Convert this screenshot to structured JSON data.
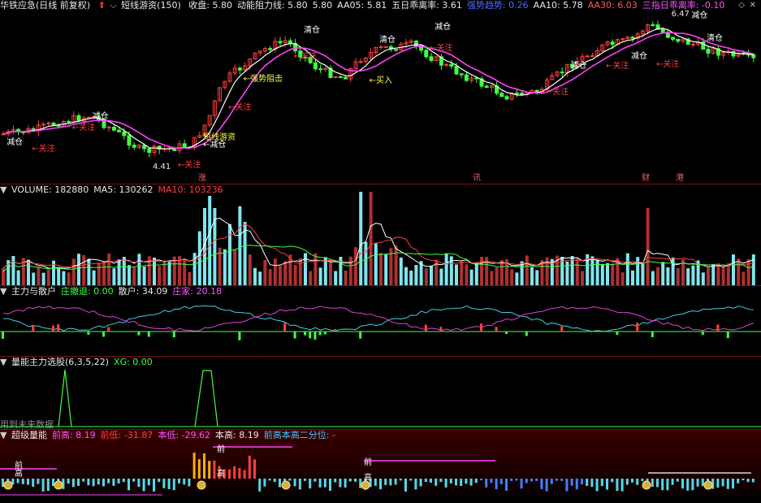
{
  "main_header": {
    "stock_title": "华铁应急(日线 前复权)",
    "indicator_name": "短线游资(150)",
    "items": [
      {
        "text": "收盘: 5.80",
        "color": "#e8e8e8"
      },
      {
        "text": "动能阻力线: 5.80",
        "color": "#e8e8e8"
      },
      {
        "text": "5.80",
        "color": "#e8e8e8"
      },
      {
        "text": "AA05: 5.81",
        "color": "#e8e8e8"
      },
      {
        "text": "五日乖离率: 3.61",
        "color": "#e8e8e8"
      },
      {
        "text": "强势趋势: 0.26",
        "color": "#4b6bff"
      },
      {
        "text": "AA10: 5.78",
        "color": "#e8e8e8"
      },
      {
        "text": "AA30: 6.03",
        "color": "#ff5a5a"
      },
      {
        "text": "三指日乖离率: -0.10",
        "color": "#ff55ff"
      }
    ],
    "arrow_icon": "up-arrow-icon",
    "settings_icon": "diamond-icon"
  },
  "main_chart_labels": {
    "annotations": [
      {
        "text": "减仓",
        "color": "#ffffff"
      },
      {
        "text": "←关注",
        "color": "#ff4040"
      },
      {
        "text": "减仓",
        "color": "#ffffff"
      },
      {
        "text": "←关注",
        "color": "#ff4040"
      },
      {
        "text": "4.41",
        "color": "#e8e8e8"
      },
      {
        "text": "←关注",
        "color": "#ff4040"
      },
      {
        "text": "←减仓",
        "color": "#ffffff"
      },
      {
        "text": "短线游资",
        "color": "#ffff40"
      },
      {
        "text": "←关注",
        "color": "#ff4040"
      },
      {
        "text": "←强势阻击",
        "color": "#ffff40"
      },
      {
        "text": "清仓",
        "color": "#ffffff"
      },
      {
        "text": "←关注",
        "color": "#ff4040"
      },
      {
        "text": "清仓",
        "color": "#ffffff"
      },
      {
        "text": "←买入",
        "color": "#ffff40"
      },
      {
        "text": "减仓",
        "color": "#ffffff"
      },
      {
        "text": "←关注",
        "color": "#ff4040"
      },
      {
        "text": "清仓",
        "color": "#ffffff"
      },
      {
        "text": "←关注",
        "color": "#ff4040"
      },
      {
        "text": "减仓",
        "color": "#ffffff"
      },
      {
        "text": "←关注",
        "color": "#ff4040"
      },
      {
        "text": "6.47",
        "color": "#e8e8e8"
      },
      {
        "text": "减仓",
        "color": "#ffffff"
      },
      {
        "text": "清仓",
        "color": "#ffffff"
      },
      {
        "text": "←关注",
        "color": "#ff4040"
      }
    ],
    "event_marks": [
      "涨",
      "讯",
      "财",
      "港"
    ]
  },
  "volume_header": {
    "items": [
      {
        "text": "VOLUME: 182880",
        "color": "#e8e8e8"
      },
      {
        "text": "MA5: 130262",
        "color": "#e8e8e8"
      },
      {
        "text": "MA10: 103236",
        "color": "#ff4040"
      }
    ]
  },
  "main_force_header": {
    "items": [
      {
        "text": "主力与散户",
        "color": "#e8e8e8"
      },
      {
        "text": "庄撤退: 0.00",
        "color": "#40ff40"
      },
      {
        "text": "散户: 34.09",
        "color": "#e8e8e8"
      },
      {
        "text": "庄家: 20.18",
        "color": "#ff55ff"
      }
    ]
  },
  "stock_select_header": {
    "items": [
      {
        "text": "量能主力选股(6,3,5,22)",
        "color": "#e8e8e8"
      },
      {
        "text": "XG: 0.00",
        "color": "#40ff40"
      }
    ],
    "future_note": "用到未来数据"
  },
  "super_volume_header": {
    "items": [
      {
        "text": "超级量能",
        "color": "#e8e8e8"
      },
      {
        "text": "前高: 8.19",
        "color": "#ff55ff"
      },
      {
        "text": "前低: -31.87",
        "color": "#ff4040"
      },
      {
        "text": "本低: -29.62",
        "color": "#ff55ff"
      },
      {
        "text": "本高: 8.19",
        "color": "#e8e8e8"
      },
      {
        "text": "前高本高二分位: -",
        "color": "#40c8ff"
      }
    ],
    "marks": [
      "前",
      "高",
      "前",
      "高",
      "前",
      "高"
    ]
  },
  "colors": {
    "up": "#ff3c3c",
    "down": "#54ffff",
    "down_candle": "#40ff40",
    "ma_white": "#ffffff",
    "ma_magenta": "#ff40ff",
    "ma_yellow": "#ffff40",
    "separator": "#7a0f0f"
  },
  "chart_data": [
    {
      "type": "candlestick",
      "title": "短线游资(150)",
      "y_visible_extremes": {
        "low_marker": 4.41,
        "high_marker": 6.47
      },
      "series": [
        {
          "name": "收盘",
          "last": 5.8
        },
        {
          "name": "AA05",
          "last": 5.81
        },
        {
          "name": "AA10",
          "last": 5.78
        },
        {
          "name": "AA30",
          "last": 6.03
        }
      ]
    },
    {
      "type": "bar",
      "title": "VOLUME",
      "series": [
        {
          "name": "VOLUME",
          "last": 182880
        },
        {
          "name": "MA5",
          "last": 130262
        },
        {
          "name": "MA10",
          "last": 103236
        }
      ]
    },
    {
      "type": "line",
      "title": "主力与散户",
      "series": [
        {
          "name": "庄撤退",
          "last": 0.0
        },
        {
          "name": "散户",
          "last": 34.09
        },
        {
          "name": "庄家",
          "last": 20.18
        }
      ]
    },
    {
      "type": "line",
      "title": "量能主力选股(6,3,5,22)",
      "series": [
        {
          "name": "XG",
          "last": 0.0
        }
      ]
    },
    {
      "type": "bar",
      "title": "超级量能",
      "series": [
        {
          "name": "前高",
          "last": 8.19
        },
        {
          "name": "前低",
          "last": -31.87
        },
        {
          "name": "本低",
          "last": -29.62
        },
        {
          "name": "本高",
          "last": 8.19
        }
      ]
    }
  ]
}
